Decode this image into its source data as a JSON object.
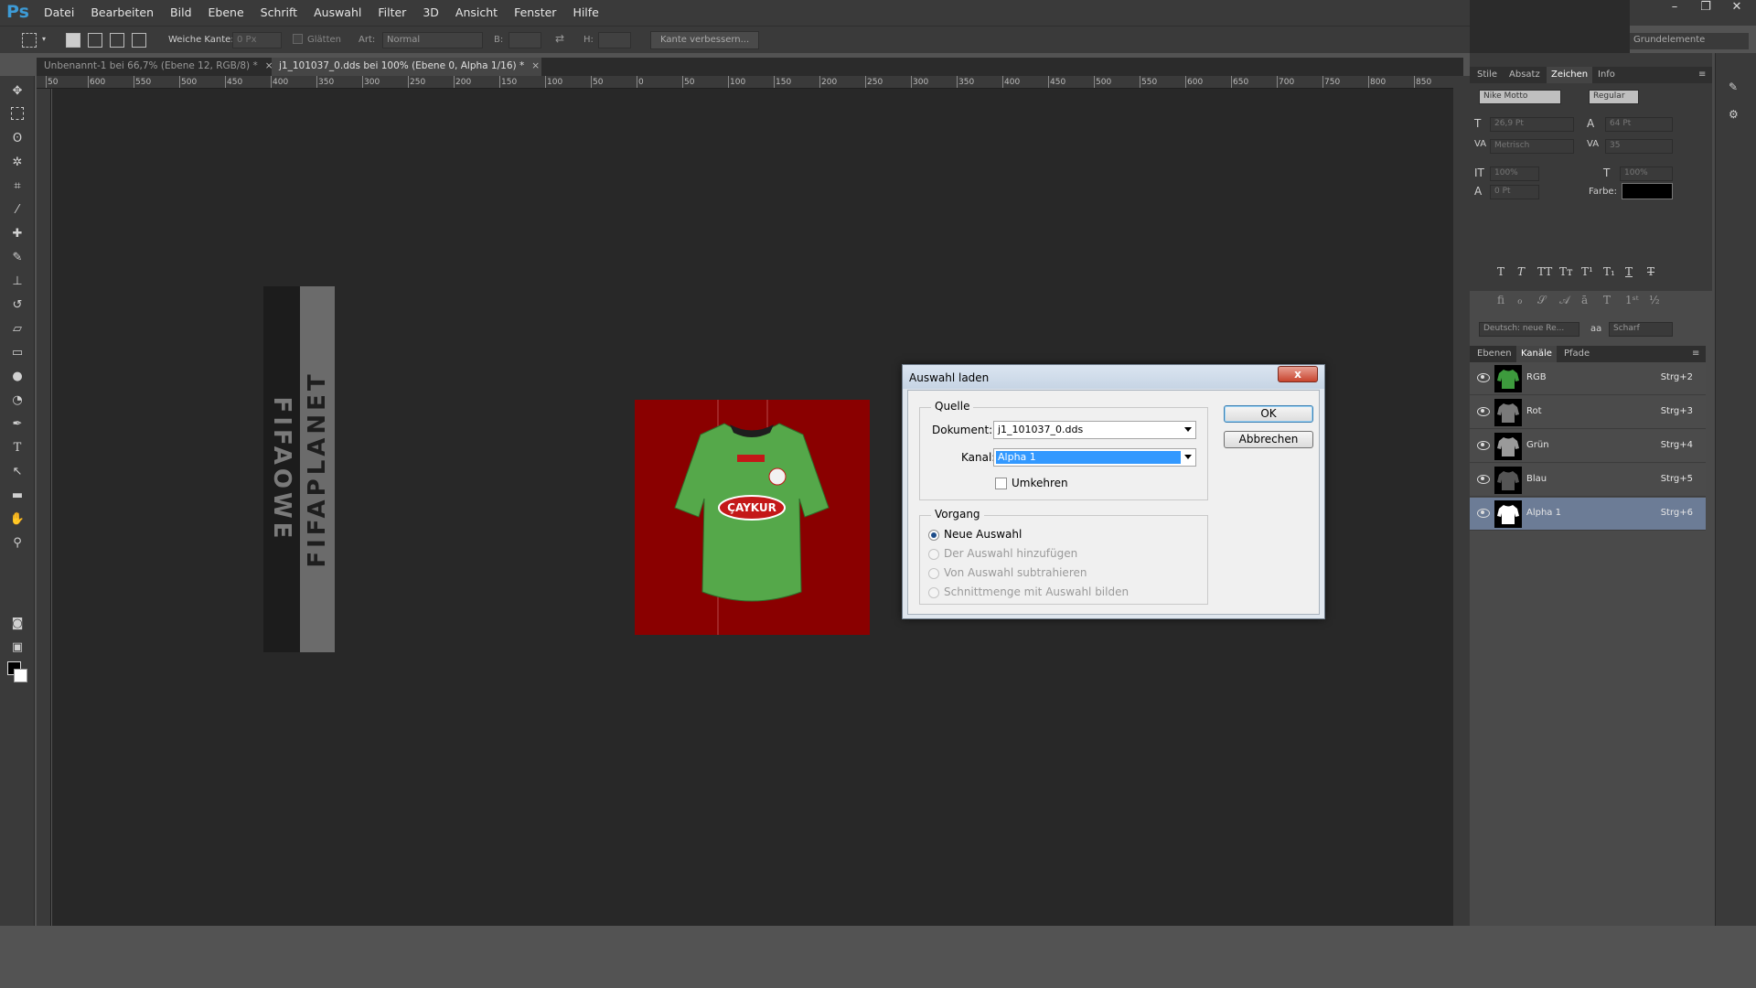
{
  "app": {
    "logo": "Ps"
  },
  "menu": [
    "Datei",
    "Bearbeiten",
    "Bild",
    "Ebene",
    "Schrift",
    "Auswahl",
    "Filter",
    "3D",
    "Ansicht",
    "Fenster",
    "Hilfe"
  ],
  "window_controls": [
    "–",
    "❐",
    "✕"
  ],
  "options": {
    "feather_label": "Weiche Kante:",
    "feather_value": "0 Px",
    "antialias_label": "Glätten",
    "style_label": "Art:",
    "style_value": "Normal",
    "width_label": "B:",
    "height_label": "H:",
    "refine_button": "Kante verbessern...",
    "workspace": "Grundelemente"
  },
  "tabs": [
    {
      "label": "Unbenannt-1 bei 66,7% (Ebene 12, RGB/8) *",
      "close": "×"
    },
    {
      "label": "j1_101037_0.dds bei 100% (Ebene 0, Alpha 1/16) *",
      "close": "×"
    }
  ],
  "ruler_h": [
    "50",
    "600",
    "550",
    "500",
    "450",
    "400",
    "350",
    "300",
    "250",
    "200",
    "150",
    "100",
    "50",
    "0",
    "50",
    "100",
    "150",
    "200",
    "250",
    "300",
    "350",
    "400",
    "450",
    "500",
    "550",
    "600",
    "650",
    "700",
    "750",
    "800",
    "850"
  ],
  "canvas": {
    "strip_text_dark": "FIFAOWE",
    "strip_text_light": "FIFAPLANET",
    "sponsor": "ÇAYKUR"
  },
  "dialog": {
    "title": "Auswahl laden",
    "close": "x",
    "source_group": "Quelle",
    "document_label": "Dokument:",
    "document_value": "j1_101037_0.dds",
    "channel_label": "Kanal:",
    "channel_value": "Alpha 1",
    "invert_label": "Umkehren",
    "operation_group": "Vorgang",
    "operations": [
      {
        "label": "Neue Auswahl",
        "checked": true,
        "disabled": false
      },
      {
        "label": "Der Auswahl hinzufügen",
        "checked": false,
        "disabled": true
      },
      {
        "label": "Von Auswahl subtrahieren",
        "checked": false,
        "disabled": true
      },
      {
        "label": "Schnittmenge mit Auswahl bilden",
        "checked": false,
        "disabled": true
      }
    ],
    "ok": "OK",
    "cancel": "Abbrechen"
  },
  "char_panel": {
    "tabs": [
      "Stile",
      "Absatz",
      "Zeichen",
      "Info"
    ],
    "font_family": "Nike Motto",
    "font_style": "Regular",
    "font_size": "26,9 Pt",
    "leading": "64 Pt",
    "kerning": "Metrisch",
    "tracking": "35",
    "vscale": "100%",
    "hscale": "100%",
    "baseline": "0 Pt",
    "color_label": "Farbe:",
    "language": "Deutsch: neue Re...",
    "aa_label": "aa",
    "antialias": "Scharf",
    "color": "#000000"
  },
  "channels_panel": {
    "tabs": [
      "Ebenen",
      "Kanäle",
      "Pfade"
    ],
    "rows": [
      {
        "name": "RGB",
        "key": "Strg+2",
        "thumb": "#3d9b3d"
      },
      {
        "name": "Rot",
        "key": "Strg+3",
        "thumb": "#7a7a7a"
      },
      {
        "name": "Grün",
        "key": "Strg+4",
        "thumb": "#9a9a9a"
      },
      {
        "name": "Blau",
        "key": "Strg+5",
        "thumb": "#555555"
      },
      {
        "name": "Alpha 1",
        "key": "Strg+6",
        "thumb": "#ffffff"
      }
    ]
  }
}
